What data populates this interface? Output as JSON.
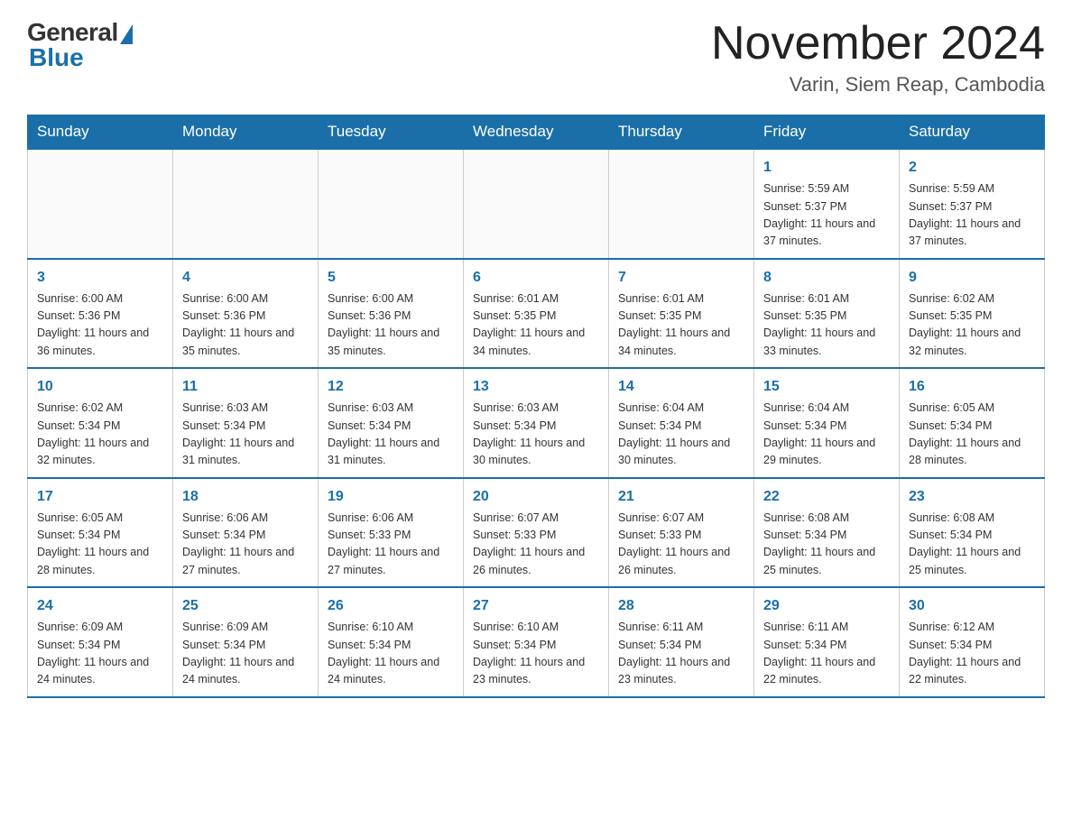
{
  "logo": {
    "general": "General",
    "blue": "Blue"
  },
  "title": "November 2024",
  "location": "Varin, Siem Reap, Cambodia",
  "days_of_week": [
    "Sunday",
    "Monday",
    "Tuesday",
    "Wednesday",
    "Thursday",
    "Friday",
    "Saturday"
  ],
  "weeks": [
    [
      {
        "day": "",
        "info": ""
      },
      {
        "day": "",
        "info": ""
      },
      {
        "day": "",
        "info": ""
      },
      {
        "day": "",
        "info": ""
      },
      {
        "day": "",
        "info": ""
      },
      {
        "day": "1",
        "info": "Sunrise: 5:59 AM\nSunset: 5:37 PM\nDaylight: 11 hours and 37 minutes."
      },
      {
        "day": "2",
        "info": "Sunrise: 5:59 AM\nSunset: 5:37 PM\nDaylight: 11 hours and 37 minutes."
      }
    ],
    [
      {
        "day": "3",
        "info": "Sunrise: 6:00 AM\nSunset: 5:36 PM\nDaylight: 11 hours and 36 minutes."
      },
      {
        "day": "4",
        "info": "Sunrise: 6:00 AM\nSunset: 5:36 PM\nDaylight: 11 hours and 35 minutes."
      },
      {
        "day": "5",
        "info": "Sunrise: 6:00 AM\nSunset: 5:36 PM\nDaylight: 11 hours and 35 minutes."
      },
      {
        "day": "6",
        "info": "Sunrise: 6:01 AM\nSunset: 5:35 PM\nDaylight: 11 hours and 34 minutes."
      },
      {
        "day": "7",
        "info": "Sunrise: 6:01 AM\nSunset: 5:35 PM\nDaylight: 11 hours and 34 minutes."
      },
      {
        "day": "8",
        "info": "Sunrise: 6:01 AM\nSunset: 5:35 PM\nDaylight: 11 hours and 33 minutes."
      },
      {
        "day": "9",
        "info": "Sunrise: 6:02 AM\nSunset: 5:35 PM\nDaylight: 11 hours and 32 minutes."
      }
    ],
    [
      {
        "day": "10",
        "info": "Sunrise: 6:02 AM\nSunset: 5:34 PM\nDaylight: 11 hours and 32 minutes."
      },
      {
        "day": "11",
        "info": "Sunrise: 6:03 AM\nSunset: 5:34 PM\nDaylight: 11 hours and 31 minutes."
      },
      {
        "day": "12",
        "info": "Sunrise: 6:03 AM\nSunset: 5:34 PM\nDaylight: 11 hours and 31 minutes."
      },
      {
        "day": "13",
        "info": "Sunrise: 6:03 AM\nSunset: 5:34 PM\nDaylight: 11 hours and 30 minutes."
      },
      {
        "day": "14",
        "info": "Sunrise: 6:04 AM\nSunset: 5:34 PM\nDaylight: 11 hours and 30 minutes."
      },
      {
        "day": "15",
        "info": "Sunrise: 6:04 AM\nSunset: 5:34 PM\nDaylight: 11 hours and 29 minutes."
      },
      {
        "day": "16",
        "info": "Sunrise: 6:05 AM\nSunset: 5:34 PM\nDaylight: 11 hours and 28 minutes."
      }
    ],
    [
      {
        "day": "17",
        "info": "Sunrise: 6:05 AM\nSunset: 5:34 PM\nDaylight: 11 hours and 28 minutes."
      },
      {
        "day": "18",
        "info": "Sunrise: 6:06 AM\nSunset: 5:34 PM\nDaylight: 11 hours and 27 minutes."
      },
      {
        "day": "19",
        "info": "Sunrise: 6:06 AM\nSunset: 5:33 PM\nDaylight: 11 hours and 27 minutes."
      },
      {
        "day": "20",
        "info": "Sunrise: 6:07 AM\nSunset: 5:33 PM\nDaylight: 11 hours and 26 minutes."
      },
      {
        "day": "21",
        "info": "Sunrise: 6:07 AM\nSunset: 5:33 PM\nDaylight: 11 hours and 26 minutes."
      },
      {
        "day": "22",
        "info": "Sunrise: 6:08 AM\nSunset: 5:34 PM\nDaylight: 11 hours and 25 minutes."
      },
      {
        "day": "23",
        "info": "Sunrise: 6:08 AM\nSunset: 5:34 PM\nDaylight: 11 hours and 25 minutes."
      }
    ],
    [
      {
        "day": "24",
        "info": "Sunrise: 6:09 AM\nSunset: 5:34 PM\nDaylight: 11 hours and 24 minutes."
      },
      {
        "day": "25",
        "info": "Sunrise: 6:09 AM\nSunset: 5:34 PM\nDaylight: 11 hours and 24 minutes."
      },
      {
        "day": "26",
        "info": "Sunrise: 6:10 AM\nSunset: 5:34 PM\nDaylight: 11 hours and 24 minutes."
      },
      {
        "day": "27",
        "info": "Sunrise: 6:10 AM\nSunset: 5:34 PM\nDaylight: 11 hours and 23 minutes."
      },
      {
        "day": "28",
        "info": "Sunrise: 6:11 AM\nSunset: 5:34 PM\nDaylight: 11 hours and 23 minutes."
      },
      {
        "day": "29",
        "info": "Sunrise: 6:11 AM\nSunset: 5:34 PM\nDaylight: 11 hours and 22 minutes."
      },
      {
        "day": "30",
        "info": "Sunrise: 6:12 AM\nSunset: 5:34 PM\nDaylight: 11 hours and 22 minutes."
      }
    ]
  ]
}
